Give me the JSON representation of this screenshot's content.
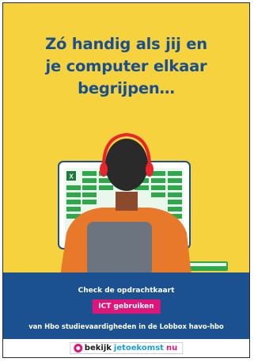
{
  "poster": {
    "headline": "Zó handig als jij en\nje computer elkaar\nbegrijpen…",
    "cta_line1": "Check de opdrachtkaart",
    "badge": "ICT gebruiken",
    "cta_line2": "van Hbo studievaardigheden in de Lobbox havo-hbo",
    "brand": {
      "part1": "bekijk",
      "part2": "jetoekomst",
      "part3": "nu"
    }
  },
  "colors": {
    "yellow": "#f6d23f",
    "blue": "#1b5191",
    "pink": "#e0157a",
    "green": "#2ea84a",
    "hair": "#2a2a2a",
    "shirt": "#e8782a",
    "headset": "#e8252a"
  },
  "icons": [
    "excel-icon",
    "headset-icon",
    "logo-dot-icon"
  ]
}
